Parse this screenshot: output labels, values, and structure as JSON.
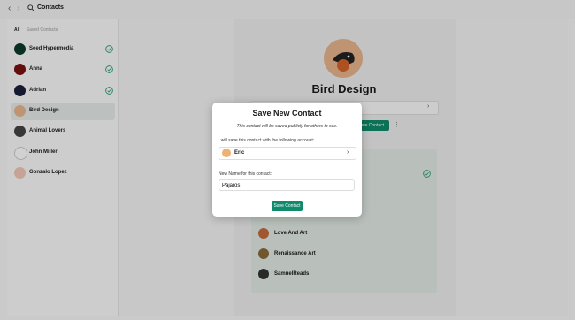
{
  "topbar": {
    "title": "Contacts",
    "back_icon": "chevron-left-icon",
    "forward_icon": "chevron-right-icon",
    "search_icon": "search-icon"
  },
  "sidebar": {
    "tabs": [
      {
        "label": "All",
        "active": true
      },
      {
        "label": "Saved Contacts",
        "active": false
      }
    ],
    "items": [
      {
        "label": "Seed Hypermedia",
        "verified": true,
        "avatar_color": "#0d3b2e"
      },
      {
        "label": "Anna",
        "verified": true,
        "avatar_color": "#7a1010"
      },
      {
        "label": "Adrian",
        "verified": true,
        "avatar_color": "#1a1f3a"
      },
      {
        "label": "Bird Design",
        "verified": false,
        "active": true,
        "avatar_color": "#e8b58c"
      },
      {
        "label": "Animal Lovers",
        "verified": false,
        "avatar_color": "#444444"
      },
      {
        "label": "John Miller",
        "verified": false,
        "avatar_color": "#ffffff"
      },
      {
        "label": "Gonzalo Lopez",
        "verified": false,
        "avatar_color": "#f2c7b8"
      }
    ]
  },
  "profile": {
    "name": "Bird Design",
    "save_button_label": "Save Contact",
    "list": [
      {
        "label": "Love And Art",
        "avatar_color": "#c46a3c"
      },
      {
        "label": "Renaissance Art",
        "avatar_color": "#8a6a3a"
      },
      {
        "label": "SamuelReads",
        "avatar_color": "#333333"
      }
    ]
  },
  "modal": {
    "title": "Save New Contact",
    "description": "This contact will be saved publicly for others to see.",
    "account_label": "I will save this contact with the following account:",
    "account_name": "Eric",
    "name_label": "New Name for this contact:",
    "name_value": "Pajaros",
    "save_label": "Save Contact"
  },
  "colors": {
    "accent": "#0f8a6b",
    "verified": "#2c9e7a"
  }
}
